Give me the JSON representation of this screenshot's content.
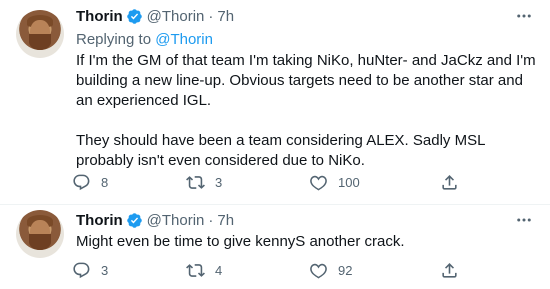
{
  "tweets": [
    {
      "author_name": "Thorin",
      "handle": "@Thorin",
      "separator": "·",
      "time": "7h",
      "replying_label": "Replying to",
      "replying_handle": "@Thorin",
      "paragraphs": [
        "If I'm the GM of that team I'm taking NiKo, huNter- and JaCkz and I'm building a new line-up.  Obvious targets need to be another star and an experienced IGL.",
        "They should have been a team considering ALEX.  Sadly MSL probably isn't even considered due to NiKo."
      ],
      "replies": "8",
      "retweets": "3",
      "likes": "100"
    },
    {
      "author_name": "Thorin",
      "handle": "@Thorin",
      "separator": "·",
      "time": "7h",
      "text": "Might even be time to give kennyS another crack.",
      "replies": "3",
      "retweets": "4",
      "likes": "92"
    }
  ],
  "icons": {
    "verified": "verified-badge-icon",
    "more": "more-dots-icon",
    "reply": "reply-icon",
    "retweet": "retweet-icon",
    "like": "heart-icon",
    "share": "share-icon"
  },
  "colors": {
    "accent": "#1d9bf0",
    "text": "#0f1419",
    "muted": "#536471",
    "divider": "#eff3f4"
  }
}
